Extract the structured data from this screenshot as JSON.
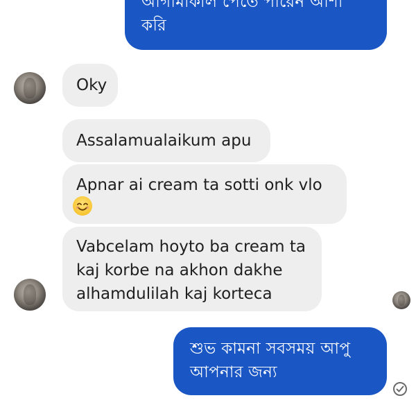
{
  "messages": [
    {
      "direction": "outgoing",
      "lines": [
        "আগামীকাল পেতে পারেন আশা",
        "করি"
      ]
    },
    {
      "direction": "incoming",
      "lines": [
        "Oky"
      ]
    },
    {
      "direction": "incoming",
      "lines": [
        "Assalamualaikum apu"
      ]
    },
    {
      "direction": "incoming",
      "lines": [
        "Apnar ai cream ta sotti onk vlo"
      ],
      "emoji": "smiling-face-emoji"
    },
    {
      "direction": "incoming",
      "lines": [
        "Vabcelam hoyto ba cream ta",
        "kaj korbe na akhon dakhe",
        "alhamdulilah kaj korteca"
      ]
    },
    {
      "direction": "outgoing",
      "lines": [
        "শুভ কামনা সবসময় আপু",
        "আপনার জন্য"
      ]
    }
  ],
  "icons": {
    "avatar": "contact-avatar",
    "seen": "seen-check-icon",
    "emoji": "smiling-face-emoji"
  },
  "colors": {
    "outgoing_bubble": "#1a56c4",
    "outgoing_text": "#ffffff",
    "incoming_bubble": "#eeeeef",
    "incoming_text": "#1f1f1f"
  }
}
